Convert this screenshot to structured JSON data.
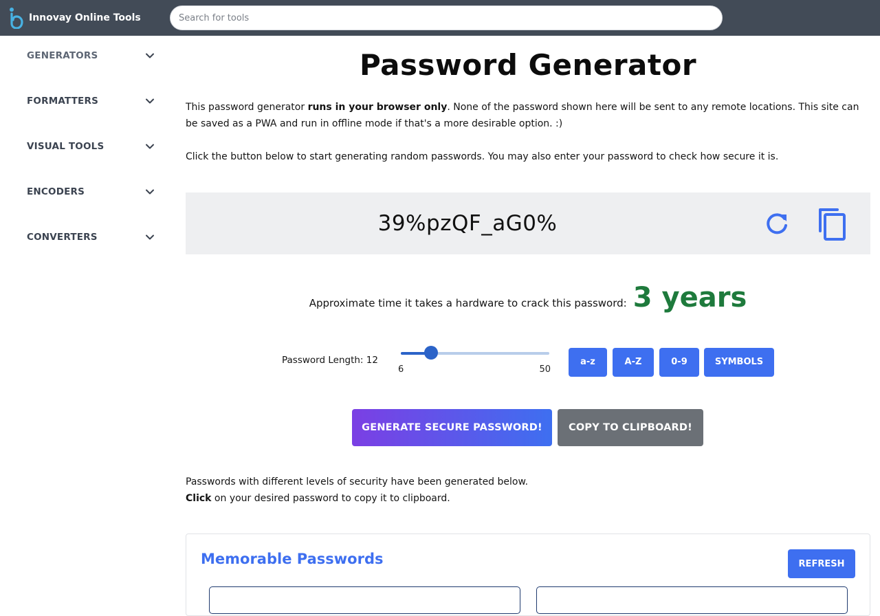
{
  "app": {
    "name": "Innovay Online Tools"
  },
  "search": {
    "placeholder": "Search for tools",
    "value": ""
  },
  "sidebar": {
    "items": [
      {
        "label": "GENERATORS",
        "icon": "chevron-down-icon"
      },
      {
        "label": "FORMATTERS",
        "icon": "chevron-down-icon"
      },
      {
        "label": "VISUAL TOOLS",
        "icon": "chevron-down-icon"
      },
      {
        "label": "ENCODERS",
        "icon": "chevron-down-icon"
      },
      {
        "label": "CONVERTERS",
        "icon": "chevron-down-icon"
      }
    ]
  },
  "main": {
    "title": "Password Generator",
    "intro_prefix": "This password generator ",
    "intro_bold": "runs in your browser only",
    "intro_suffix": ". None of the password shown here will be sent to any remote locations. This site can be saved as a PWA and run in offline mode if that's a more desirable option. :)",
    "instructions": "Click the button below to start generating random passwords. You may also enter your password to check how secure it is.",
    "password": "39%pzQF_aG0%",
    "crack_label": "Approximate time it takes a hardware to crack this password:",
    "crack_time": "3 years",
    "length_label": "Password Length: 12",
    "slider": {
      "min": "6",
      "max": "50",
      "value": 12
    },
    "toggles": [
      "a-z",
      "A-Z",
      "0-9",
      "SYMBOLS"
    ],
    "generate_label": "GENERATE SECURE PASSWORD!",
    "copy_label": "COPY TO CLIPBOARD!",
    "levels_text": "Passwords with different levels of security have been generated below.",
    "click_bold": "Click",
    "click_suffix": " on your desired password to copy it to clipboard."
  },
  "memorable": {
    "title": "Memorable Passwords",
    "refresh_label": "REFRESH"
  },
  "colors": {
    "topbar": "#424b57",
    "accent": "#3e6ff0",
    "success": "#1e7a3c",
    "panel": "#eeeff1",
    "secondary_button": "#6b7076"
  }
}
